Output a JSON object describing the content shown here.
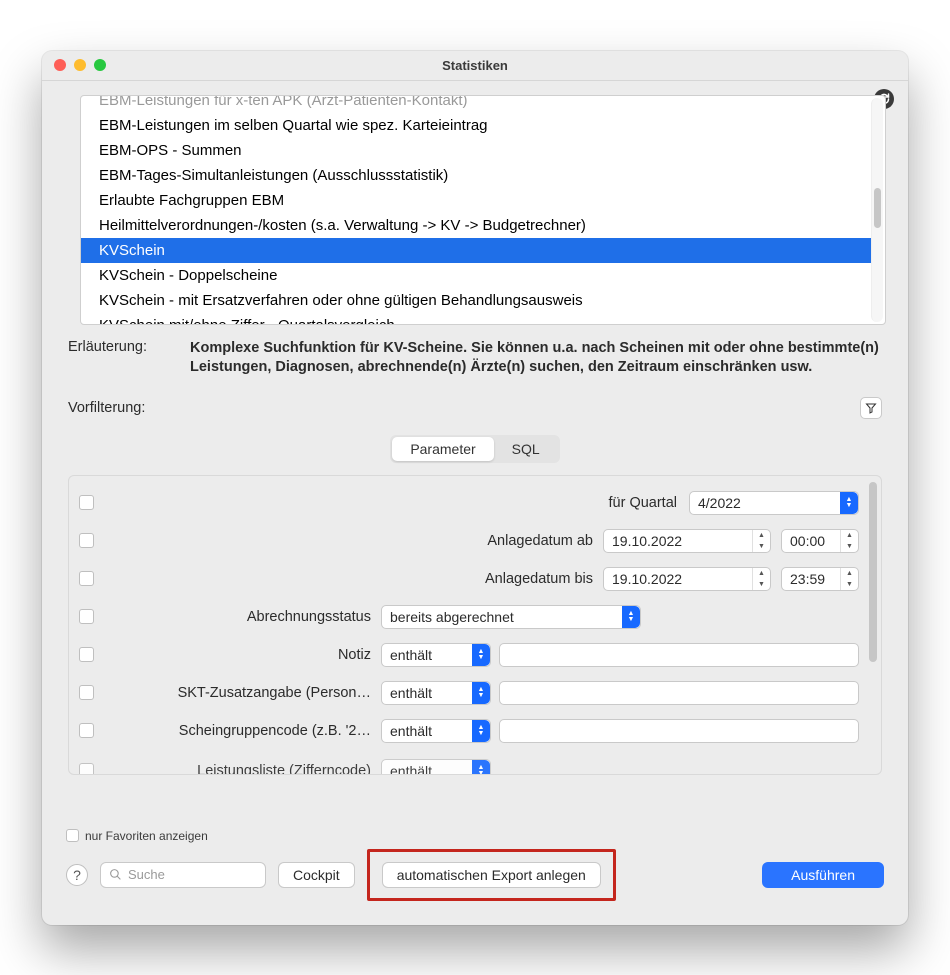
{
  "window": {
    "title": "Statistiken"
  },
  "list": {
    "items": [
      {
        "label": "EBM-Leistungen für x-ten APK (Arzt-Patienten-Kontakt)",
        "cut": true
      },
      {
        "label": "EBM-Leistungen im selben Quartal wie spez. Karteieintrag"
      },
      {
        "label": "EBM-OPS - Summen"
      },
      {
        "label": "EBM-Tages-Simultanleistungen (Ausschlussstatistik)"
      },
      {
        "label": "Erlaubte Fachgruppen EBM"
      },
      {
        "label": "Heilmittelverordnungen-/kosten (s.a. Verwaltung -> KV -> Budgetrechner)"
      },
      {
        "label": "KVSchein",
        "selected": true
      },
      {
        "label": "KVSchein - Doppelscheine"
      },
      {
        "label": "KVSchein - mit Ersatzverfahren oder ohne gültigen Behandlungsausweis"
      },
      {
        "label": "KVSchein mit/ohne Ziffer - Quartalsvergleich"
      }
    ]
  },
  "description": {
    "label": "Erläuterung:",
    "text": "Komplexe Suchfunktion für KV-Scheine. Sie können u.a. nach Scheinen mit oder ohne bestimmte(n) Leistungen, Diagnosen, abrechnende(n) Ärzte(n) suchen, den Zeitraum einschränken usw."
  },
  "prefilter": {
    "label": "Vorfilterung:"
  },
  "tabs": {
    "parameter": "Parameter",
    "sql": "SQL",
    "active": "parameter"
  },
  "params": {
    "quartal_label": "für Quartal",
    "quartal_value": "4/2022",
    "anlage_ab_label": "Anlagedatum ab",
    "anlage_ab_date": "19.10.2022",
    "anlage_ab_time": "00:00",
    "anlage_bis_label": "Anlagedatum bis",
    "anlage_bis_date": "19.10.2022",
    "anlage_bis_time": "23:59",
    "abrechnung_label": "Abrechnungsstatus",
    "abrechnung_value": "bereits abgerechnet",
    "notiz_label": "Notiz",
    "skt_label": "SKT-Zusatzangabe (Person…",
    "scheingruppe_label": "Scheingruppencode (z.B. '2…",
    "leistungsliste_label": "Leistungsliste (Zifferncode)",
    "op_enthaelt": "enthält"
  },
  "footer": {
    "favorites_label": "nur Favoriten anzeigen",
    "search_placeholder": "Suche",
    "cockpit": "Cockpit",
    "export": "automatischen Export anlegen",
    "execute": "Ausführen"
  }
}
